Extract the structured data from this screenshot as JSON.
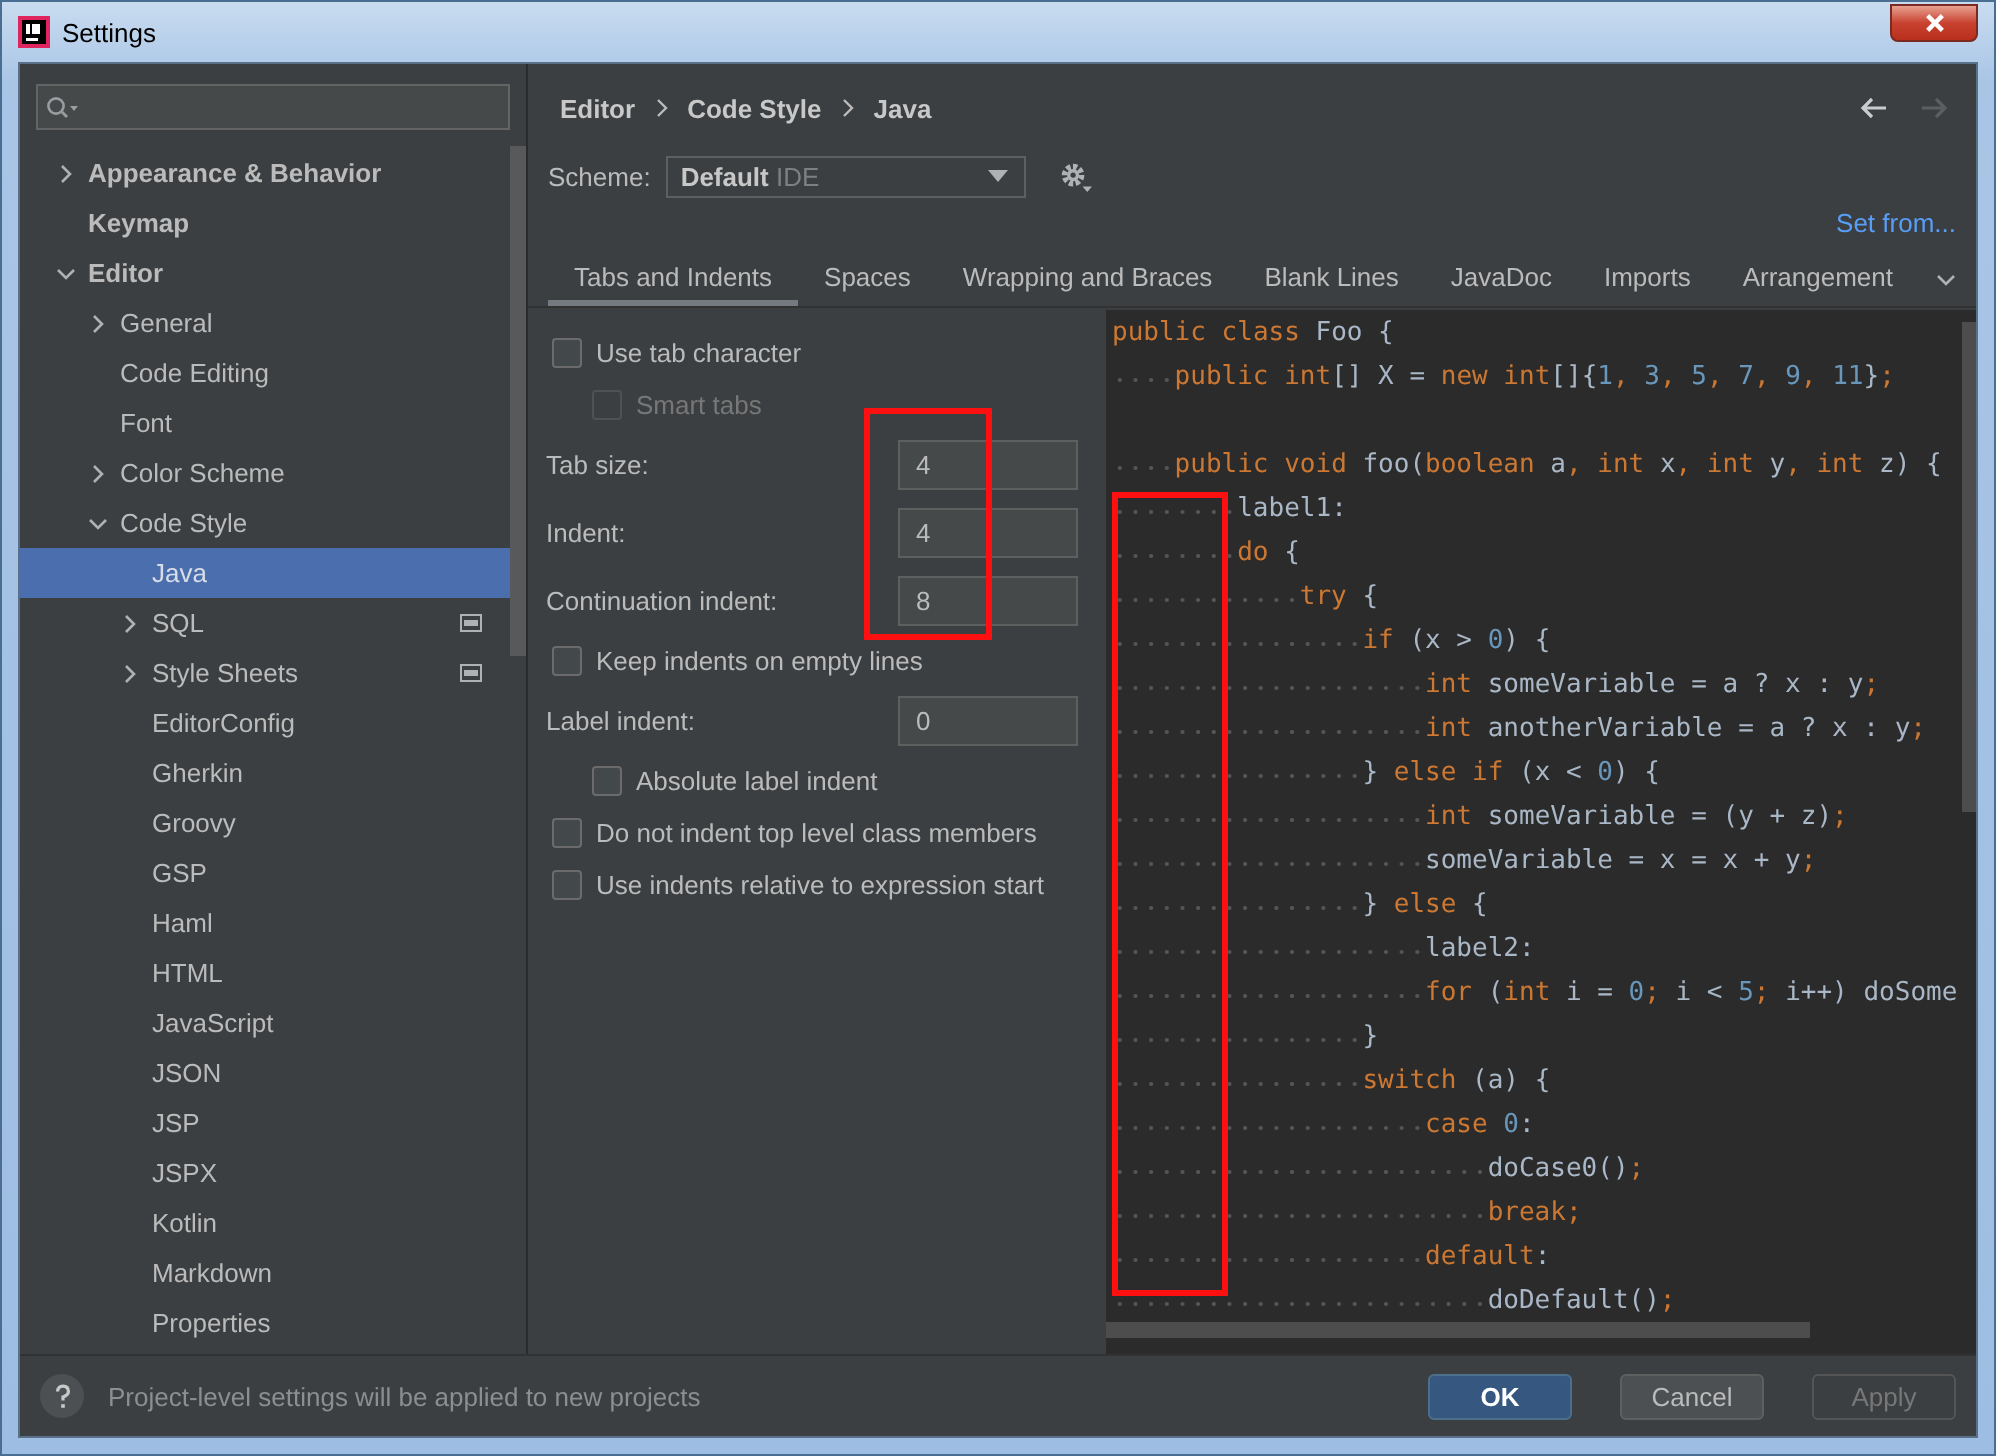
{
  "window": {
    "title": "Settings"
  },
  "sidebar": {
    "items": [
      {
        "label": "Appearance & Behavior",
        "bold": true,
        "expanded": false,
        "selected": false
      },
      {
        "label": "Keymap",
        "bold": true,
        "selected": false
      },
      {
        "label": "Editor",
        "bold": true,
        "expanded": true,
        "selected": false,
        "children": [
          {
            "label": "General",
            "expanded": false,
            "selected": false
          },
          {
            "label": "Code Editing",
            "selected": false
          },
          {
            "label": "Font",
            "selected": false
          },
          {
            "label": "Color Scheme",
            "expanded": false,
            "selected": false
          },
          {
            "label": "Code Style",
            "expanded": true,
            "selected": false,
            "children": [
              {
                "label": "Java",
                "selected": true
              },
              {
                "label": "SQL",
                "expanded": false,
                "selected": false,
                "project_scope": true
              },
              {
                "label": "Style Sheets",
                "expanded": false,
                "selected": false,
                "project_scope": true
              },
              {
                "label": "EditorConfig",
                "selected": false
              },
              {
                "label": "Gherkin",
                "selected": false
              },
              {
                "label": "Groovy",
                "selected": false
              },
              {
                "label": "GSP",
                "selected": false
              },
              {
                "label": "Haml",
                "selected": false
              },
              {
                "label": "HTML",
                "selected": false
              },
              {
                "label": "JavaScript",
                "selected": false
              },
              {
                "label": "JSON",
                "selected": false
              },
              {
                "label": "JSP",
                "selected": false
              },
              {
                "label": "JSPX",
                "selected": false
              },
              {
                "label": "Kotlin",
                "selected": false
              },
              {
                "label": "Markdown",
                "selected": false
              },
              {
                "label": "Properties",
                "selected": false
              }
            ]
          }
        ]
      }
    ]
  },
  "breadcrumb": [
    "Editor",
    "Code Style",
    "Java"
  ],
  "nav": {
    "back_disabled": false,
    "forward_disabled": true
  },
  "scheme": {
    "label": "Scheme:",
    "name": "Default",
    "scope": "IDE",
    "set_from": "Set from..."
  },
  "tabs": [
    {
      "label": "Tabs and Indents",
      "selected": true
    },
    {
      "label": "Spaces",
      "selected": false
    },
    {
      "label": "Wrapping and Braces",
      "selected": false
    },
    {
      "label": "Blank Lines",
      "selected": false
    },
    {
      "label": "JavaDoc",
      "selected": false
    },
    {
      "label": "Imports",
      "selected": false
    },
    {
      "label": "Arrangement",
      "selected": false
    }
  ],
  "options": [
    {
      "kind": "checkbox",
      "label": "Use tab character",
      "checked": false,
      "disabled": false,
      "children": [
        {
          "kind": "checkbox",
          "label": "Smart tabs",
          "checked": false,
          "disabled": true
        }
      ]
    },
    {
      "kind": "field",
      "label": "Tab size:",
      "value": "4"
    },
    {
      "kind": "field",
      "label": "Indent:",
      "value": "4"
    },
    {
      "kind": "field",
      "label": "Continuation indent:",
      "value": "8"
    },
    {
      "kind": "checkbox",
      "label": "Keep indents on empty lines",
      "checked": false,
      "disabled": false
    },
    {
      "kind": "field",
      "label": "Label indent:",
      "value": "0",
      "children": [
        {
          "kind": "checkbox",
          "label": "Absolute label indent",
          "checked": false,
          "disabled": false
        }
      ]
    },
    {
      "kind": "checkbox",
      "label": "Do not indent top level class members",
      "checked": false,
      "disabled": false
    },
    {
      "kind": "checkbox",
      "label": "Use indents relative to expression start",
      "checked": false,
      "disabled": false
    }
  ],
  "code_lines": [
    {
      "kind": "code",
      "tokens": [
        {
          "text": "public class ",
          "kind": "keyword"
        },
        {
          "text": "Foo {",
          "kind": "plain"
        }
      ],
      "children": [
        {
          "kind": "code",
          "tokens": [
            {
              "text": "public int",
              "kind": "keyword"
            },
            {
              "text": "[] X = ",
              "kind": "plain"
            },
            {
              "text": "new int",
              "kind": "keyword"
            },
            {
              "text": "[]{",
              "kind": "plain"
            },
            {
              "text": "1",
              "kind": "number"
            },
            {
              "text": ", ",
              "kind": "keyword"
            },
            {
              "text": "3",
              "kind": "number"
            },
            {
              "text": ", ",
              "kind": "keyword"
            },
            {
              "text": "5",
              "kind": "number"
            },
            {
              "text": ", ",
              "kind": "keyword"
            },
            {
              "text": "7",
              "kind": "number"
            },
            {
              "text": ", ",
              "kind": "keyword"
            },
            {
              "text": "9",
              "kind": "number"
            },
            {
              "text": ", ",
              "kind": "keyword"
            },
            {
              "text": "11",
              "kind": "number"
            },
            {
              "text": "}",
              "kind": "plain"
            },
            {
              "text": ";",
              "kind": "keyword"
            }
          ]
        },
        {
          "kind": "blank"
        },
        {
          "kind": "code",
          "tokens": [
            {
              "text": "public void ",
              "kind": "keyword"
            },
            {
              "text": "foo(",
              "kind": "plain"
            },
            {
              "text": "boolean ",
              "kind": "keyword"
            },
            {
              "text": "a",
              "kind": "plain"
            },
            {
              "text": ", int ",
              "kind": "keyword"
            },
            {
              "text": "x",
              "kind": "plain"
            },
            {
              "text": ", int ",
              "kind": "keyword"
            },
            {
              "text": "y",
              "kind": "plain"
            },
            {
              "text": ", int ",
              "kind": "keyword"
            },
            {
              "text": "z) {",
              "kind": "plain"
            }
          ],
          "children": [
            {
              "kind": "code",
              "tokens": [
                {
                  "text": "label1:",
                  "kind": "plain"
                }
              ]
            },
            {
              "kind": "code",
              "tokens": [
                {
                  "text": "do ",
                  "kind": "keyword"
                },
                {
                  "text": "{",
                  "kind": "plain"
                }
              ],
              "children": [
                {
                  "kind": "code",
                  "tokens": [
                    {
                      "text": "try ",
                      "kind": "keyword"
                    },
                    {
                      "text": "{",
                      "kind": "plain"
                    }
                  ],
                  "children": [
                    {
                      "kind": "code",
                      "tokens": [
                        {
                          "text": "if ",
                          "kind": "keyword"
                        },
                        {
                          "text": "(x > ",
                          "kind": "plain"
                        },
                        {
                          "text": "0",
                          "kind": "number"
                        },
                        {
                          "text": ") {",
                          "kind": "plain"
                        }
                      ],
                      "children": [
                        {
                          "kind": "code",
                          "tokens": [
                            {
                              "text": "int ",
                              "kind": "keyword"
                            },
                            {
                              "text": "someVariable = a ? x : y",
                              "kind": "plain"
                            },
                            {
                              "text": ";",
                              "kind": "keyword"
                            }
                          ]
                        },
                        {
                          "kind": "code",
                          "tokens": [
                            {
                              "text": "int ",
                              "kind": "keyword"
                            },
                            {
                              "text": "anotherVariable = a ? x : y",
                              "kind": "plain"
                            },
                            {
                              "text": ";",
                              "kind": "keyword"
                            }
                          ]
                        }
                      ]
                    },
                    {
                      "kind": "code",
                      "tokens": [
                        {
                          "text": "} ",
                          "kind": "plain"
                        },
                        {
                          "text": "else if ",
                          "kind": "keyword"
                        },
                        {
                          "text": "(x < ",
                          "kind": "plain"
                        },
                        {
                          "text": "0",
                          "kind": "number"
                        },
                        {
                          "text": ") {",
                          "kind": "plain"
                        }
                      ],
                      "children": [
                        {
                          "kind": "code",
                          "tokens": [
                            {
                              "text": "int ",
                              "kind": "keyword"
                            },
                            {
                              "text": "someVariable = (y + z)",
                              "kind": "plain"
                            },
                            {
                              "text": ";",
                              "kind": "keyword"
                            }
                          ]
                        },
                        {
                          "kind": "code",
                          "tokens": [
                            {
                              "text": "someVariable = x = x + y",
                              "kind": "plain"
                            },
                            {
                              "text": ";",
                              "kind": "keyword"
                            }
                          ]
                        }
                      ]
                    },
                    {
                      "kind": "code",
                      "tokens": [
                        {
                          "text": "} ",
                          "kind": "plain"
                        },
                        {
                          "text": "else ",
                          "kind": "keyword"
                        },
                        {
                          "text": "{",
                          "kind": "plain"
                        }
                      ],
                      "children": [
                        {
                          "kind": "code",
                          "tokens": [
                            {
                              "text": "label2:",
                              "kind": "plain"
                            }
                          ]
                        },
                        {
                          "kind": "code",
                          "tokens": [
                            {
                              "text": "for ",
                              "kind": "keyword"
                            },
                            {
                              "text": "(",
                              "kind": "plain"
                            },
                            {
                              "text": "int ",
                              "kind": "keyword"
                            },
                            {
                              "text": "i = ",
                              "kind": "plain"
                            },
                            {
                              "text": "0",
                              "kind": "number"
                            },
                            {
                              "text": "; ",
                              "kind": "keyword"
                            },
                            {
                              "text": "i < ",
                              "kind": "plain"
                            },
                            {
                              "text": "5",
                              "kind": "number"
                            },
                            {
                              "text": "; ",
                              "kind": "keyword"
                            },
                            {
                              "text": "i++) doSome",
                              "kind": "plain"
                            }
                          ]
                        }
                      ]
                    },
                    {
                      "kind": "code",
                      "tokens": [
                        {
                          "text": "}",
                          "kind": "plain"
                        }
                      ]
                    },
                    {
                      "kind": "code",
                      "tokens": [
                        {
                          "text": "switch ",
                          "kind": "keyword"
                        },
                        {
                          "text": "(a) {",
                          "kind": "plain"
                        }
                      ],
                      "children": [
                        {
                          "kind": "code",
                          "tokens": [
                            {
                              "text": "case ",
                              "kind": "keyword"
                            },
                            {
                              "text": "0",
                              "kind": "number"
                            },
                            {
                              "text": ":",
                              "kind": "plain"
                            }
                          ],
                          "children": [
                            {
                              "kind": "code",
                              "tokens": [
                                {
                                  "text": "doCase0()",
                                  "kind": "plain"
                                },
                                {
                                  "text": ";",
                                  "kind": "keyword"
                                }
                              ]
                            },
                            {
                              "kind": "code",
                              "tokens": [
                                {
                                  "text": "break;",
                                  "kind": "keyword"
                                }
                              ]
                            }
                          ]
                        },
                        {
                          "kind": "code",
                          "tokens": [
                            {
                              "text": "default",
                              "kind": "keyword"
                            },
                            {
                              "text": ":",
                              "kind": "plain"
                            }
                          ],
                          "children": [
                            {
                              "kind": "code",
                              "tokens": [
                                {
                                  "text": "doDefault()",
                                  "kind": "plain"
                                },
                                {
                                  "text": ";",
                                  "kind": "keyword"
                                }
                              ]
                            }
                          ]
                        }
                      ]
                    }
                  ]
                }
              ]
            }
          ]
        }
      ]
    }
  ],
  "highlight_indent_fields": true,
  "highlight_indent_gutter": true,
  "footer": {
    "message": "Project-level settings will be applied to new projects"
  },
  "buttons": [
    {
      "label": "OK",
      "kind": "default",
      "disabled": false
    },
    {
      "label": "Cancel",
      "kind": "normal",
      "disabled": false
    },
    {
      "label": "Apply",
      "kind": "normal",
      "disabled": true
    }
  ]
}
